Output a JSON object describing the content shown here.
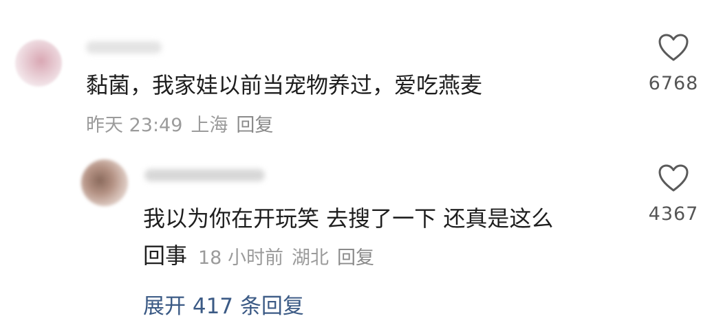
{
  "comment": {
    "text": "黏菌，我家娃以前当宠物养过，爱吃燕麦",
    "time": "昨天 23:49",
    "location": "上海",
    "reply_label": "回复",
    "likes": "6768"
  },
  "reply": {
    "text_line1": "我以为你在开玩笑 去搜了一下 还真是这么",
    "text_line2": "回事",
    "time": "18 小时前",
    "location": "湖北",
    "reply_label": "回复",
    "likes": "4367"
  },
  "expand_replies": "展开 417 条回复",
  "icons": {
    "like": "heart-outline-icon"
  }
}
